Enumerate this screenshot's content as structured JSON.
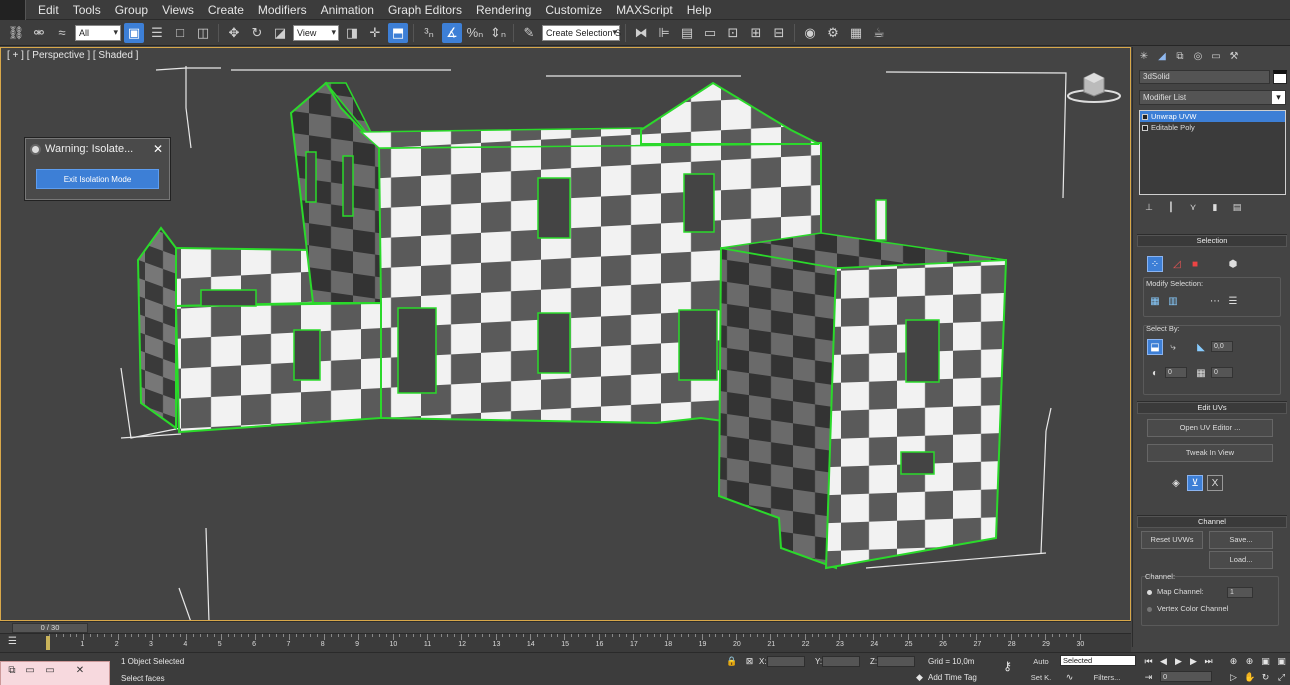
{
  "menu": [
    "Edit",
    "Tools",
    "Group",
    "Views",
    "Create",
    "Modifiers",
    "Animation",
    "Graph Editors",
    "Rendering",
    "Customize",
    "MAXScript",
    "Help"
  ],
  "toolbar": {
    "selection_filter": "All",
    "reference_coord": "View",
    "named_selection": "Create Selection S",
    "icons": [
      "link-icon",
      "unlink-icon",
      "bind-space-warp-icon",
      "select-object-icon",
      "select-by-name-icon",
      "rect-region-icon",
      "window-crossing-icon",
      "move-icon",
      "rotate-icon",
      "scale-icon",
      "pivot-icon",
      "snap-3d-icon",
      "angle-snap-icon",
      "percent-snap-icon",
      "spinner-snap-icon",
      "edit-named-sel-icon",
      "mirror-icon",
      "align-icon",
      "layer-icon",
      "graphite-icon",
      "curve-editor-icon",
      "schematic-icon",
      "material-editor-icon",
      "render-setup-icon",
      "rendered-frame-icon",
      "render-icon"
    ]
  },
  "viewport": {
    "label": "[ + ] [ Perspective ] [ Shaded ]",
    "isolate_dialog": {
      "title": "Warning: Isolate...",
      "close": "✕",
      "button": "Exit Isolation Mode"
    }
  },
  "panel": {
    "object_name": "3dSolid",
    "modifier_list": "Modifier List",
    "stack": [
      {
        "label": "Unwrap UVW",
        "selected": true
      },
      {
        "label": "Editable Poly",
        "selected": false
      }
    ],
    "selection": {
      "title": "Selection",
      "modify_selection": "Modify Selection:",
      "select_by": "Select By:",
      "angle_value": "0,0",
      "spin1": "0",
      "spin2": "0"
    },
    "edit_uvs": {
      "title": "Edit UVs",
      "open_uv_editor": "Open UV Editor ...",
      "tweak_in_view": "Tweak In View"
    },
    "channel": {
      "title": "Channel",
      "reset_uvws": "Reset UVWs",
      "save": "Save...",
      "load": "Load...",
      "channel_label": "Channel:",
      "map_channel": "Map Channel:",
      "map_channel_value": "1",
      "vertex_color_channel": "Vertex Color Channel"
    }
  },
  "timeline": {
    "slider_text": "0 / 30",
    "ticks": [
      "0",
      "1",
      "2",
      "3",
      "4",
      "5",
      "6",
      "7",
      "8",
      "9",
      "10",
      "11",
      "12",
      "13",
      "14",
      "15",
      "16",
      "17",
      "18",
      "19",
      "20",
      "21",
      "22",
      "23",
      "24",
      "25",
      "26",
      "27",
      "28",
      "29",
      "30"
    ]
  },
  "status": {
    "selection_info": "1 Object Selected",
    "prompt": "Select faces",
    "x_label": "X:",
    "y_label": "Y:",
    "z_label": "Z:",
    "grid": "Grid = 10,0m",
    "add_time_tag": "Add Time Tag",
    "auto": "Auto",
    "set_k": "Set K.",
    "selected": "Selected",
    "filters": "Filters...",
    "frame": "0"
  },
  "colors": {
    "accent": "#3d7fd6",
    "viewport_border": "#d8a84a",
    "selection_edge": "#2bd92b",
    "checker_dark": "#5a5a5a",
    "checker_light": "#f2f2f2"
  }
}
